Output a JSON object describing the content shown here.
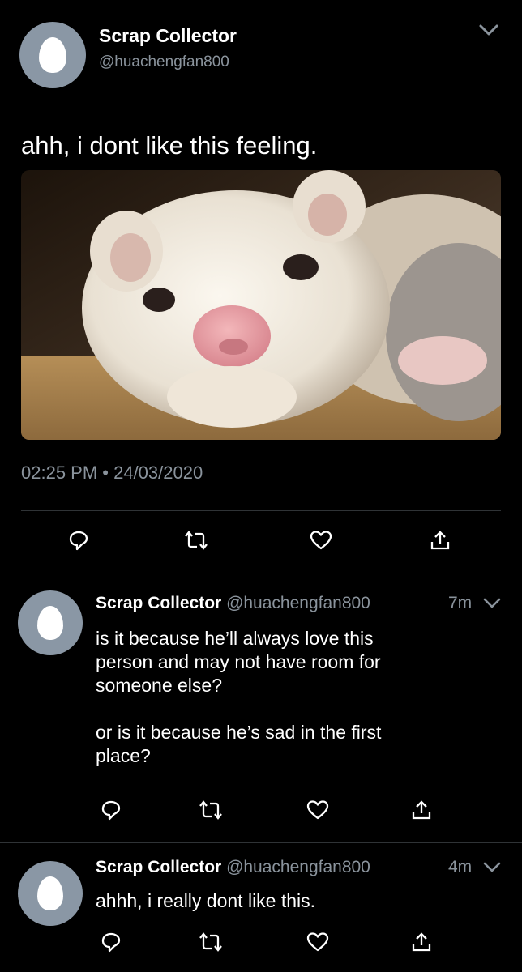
{
  "main": {
    "author_name": "Scrap Collector",
    "author_handle": "@huachengfan800",
    "text": "ahh, i dont like this feeling.",
    "timestamp": "02:25 PM • 24/03/2020",
    "media": {
      "subject": "ferret photo"
    }
  },
  "replies": [
    {
      "author_name": "Scrap Collector",
      "author_handle": "@huachengfan800",
      "time": "7m",
      "text": "is it because he’ll always love this\nperson and may not have room for\nsomeone else?\n\nor is it because he’s sad in the first\nplace?"
    },
    {
      "author_name": "Scrap Collector",
      "author_handle": "@huachengfan800",
      "time": "4m",
      "text": "ahhh, i really dont like this."
    }
  ],
  "icons": [
    "egg-avatar-icon",
    "chevron-down-icon",
    "reply-icon",
    "retweet-icon",
    "like-icon",
    "share-icon"
  ],
  "colors": {
    "background": "#000000",
    "secondary_text": "#8a939c",
    "divider": "#2f3336",
    "avatar": "#8a97a5"
  }
}
